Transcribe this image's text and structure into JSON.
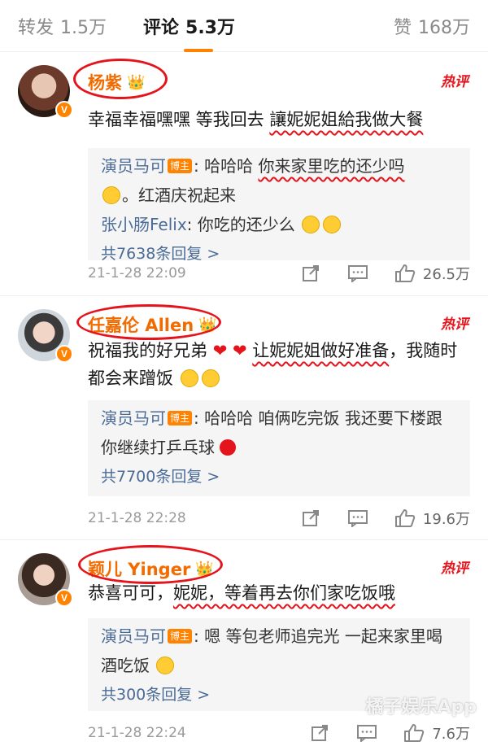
{
  "tabs": {
    "repost": {
      "label": "转发",
      "count": "1.5万"
    },
    "comments": {
      "label": "评论",
      "count": "5.3万"
    },
    "likes": {
      "label": "赞",
      "count": "168万"
    }
  },
  "hot_label": "热评",
  "reply_badge": "博主",
  "comments": [
    {
      "name": "杨紫",
      "text_plain": "幸福幸福嘿嘿 等我回去 ",
      "text_marked": "讓妮妮姐給我做大餐",
      "replies": [
        {
          "user": "演员马可",
          "text_a": ": 哈哈哈 ",
          "text_marked": "你来家里吃的还少吗",
          "text_b": "。红酒庆祝起来"
        },
        {
          "user": "张小肠Felix",
          "text_a": ": 你吃的还少么"
        }
      ],
      "total": "共7638条回复 >",
      "time": "21-1-28 22:09",
      "likes": "26.5万"
    },
    {
      "name": "任嘉伦 Allen",
      "text_plain": "祝福我的好兄弟 ",
      "text_marked": "让妮妮姐做好准备",
      "text_after": "，我随时都会来蹭饭",
      "replies": [
        {
          "user": "演员马可",
          "text_a": ": 哈哈哈 咱俩吃完饭 我还要下楼跟你继续打乒乓球"
        }
      ],
      "total": "共7700条回复 >",
      "time": "21-1-28 22:28",
      "likes": "19.6万"
    },
    {
      "name": "颖儿 Yinger",
      "text_plain": "恭喜可可，",
      "text_marked": "妮妮，等着再去你们家吃饭哦",
      "replies": [
        {
          "user": "演员马可",
          "text_a": ": 嗯 等包老师追完光 一起来家里喝酒吃饭"
        }
      ],
      "total": "共300条回复 >",
      "time": "21-1-28 22:24",
      "likes": "7.6万"
    }
  ],
  "icons": [
    "share-icon",
    "comment-icon",
    "like-icon",
    "heart-emoji",
    "grin-emoji",
    "ping-pong-emoji",
    "crown-icon",
    "verified-icon"
  ],
  "colors": {
    "accent": "#ff8200",
    "link": "#4a6b96",
    "annotation": "#e4131c"
  },
  "watermark": "橘子娱乐App"
}
